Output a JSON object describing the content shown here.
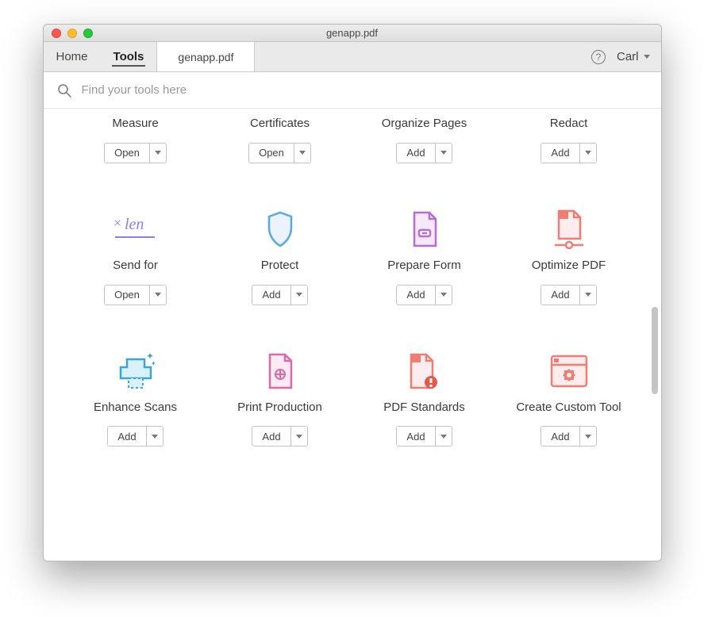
{
  "window": {
    "title": "genapp.pdf"
  },
  "nav": {
    "home": "Home",
    "tools": "Tools",
    "doc_tab": "genapp.pdf",
    "user": "Carl"
  },
  "search": {
    "placeholder": "Find your tools here"
  },
  "tools": [
    {
      "name": "Measure",
      "action": "Open",
      "icon": ""
    },
    {
      "name": "Certificates",
      "action": "Open",
      "icon": ""
    },
    {
      "name": "Organize Pages",
      "action": "Add",
      "icon": ""
    },
    {
      "name": "Redact",
      "action": "Add",
      "icon": ""
    },
    {
      "name": "Send for",
      "action": "Open",
      "icon": "sign"
    },
    {
      "name": "Protect",
      "action": "Add",
      "icon": "shield"
    },
    {
      "name": "Prepare Form",
      "action": "Add",
      "icon": "form"
    },
    {
      "name": "Optimize PDF",
      "action": "Add",
      "icon": "optimize"
    },
    {
      "name": "Enhance Scans",
      "action": "Add",
      "icon": "scan"
    },
    {
      "name": "Print Production",
      "action": "Add",
      "icon": "print"
    },
    {
      "name": "PDF Standards",
      "action": "Add",
      "icon": "standards"
    },
    {
      "name": "Create Custom Tool",
      "action": "Add",
      "icon": "custom"
    }
  ]
}
